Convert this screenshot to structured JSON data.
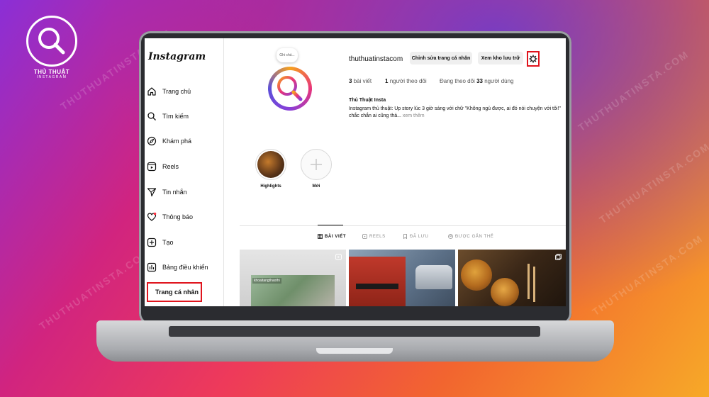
{
  "brand": {
    "line1": "THỦ THUẬT",
    "line2": "INSTAGRAM"
  },
  "watermark": "THUTHUATINSTA.COM",
  "sidebar": {
    "logo": "Instagram",
    "items": [
      {
        "label": "Trang chủ",
        "icon": "home-icon"
      },
      {
        "label": "Tìm kiếm",
        "icon": "search-icon"
      },
      {
        "label": "Khám phá",
        "icon": "compass-icon"
      },
      {
        "label": "Reels",
        "icon": "reels-icon"
      },
      {
        "label": "Tin nhắn",
        "icon": "send-icon"
      },
      {
        "label": "Thông báo",
        "icon": "heart-icon"
      },
      {
        "label": "Tạo",
        "icon": "plus-square-icon"
      },
      {
        "label": "Bảng điều khiển",
        "icon": "dashboard-icon"
      },
      {
        "label": "Trang cá nhân",
        "icon": "profile-avatar-icon"
      }
    ]
  },
  "profile": {
    "note": "Ghi chú...",
    "username": "thuthuatinstacom",
    "edit_button": "Chỉnh sửa trang cá nhân",
    "archive_button": "Xem kho lưu trữ",
    "stats": {
      "posts_count": "3",
      "posts_label": "bài viết",
      "followers_count": "1",
      "followers_label": "người theo dõi",
      "following_prefix": "Đang theo dõi",
      "following_count": "33",
      "following_label": "người dùng"
    },
    "full_name": "Thủ Thuật Insta",
    "bio": "Instagram thủ thuật: Up story lúc 3 giờ sáng với chữ \"Không ngủ được, ai đó nói chuyện với tôi!\" chắc chắn ai cũng thả...",
    "bio_more": "xem thêm"
  },
  "highlights": [
    {
      "label": "Highlights"
    },
    {
      "label": "Mới"
    }
  ],
  "tabs": [
    {
      "label": "BÀI VIẾT",
      "icon": "grid-icon",
      "active": true
    },
    {
      "label": "REELS",
      "icon": "reels-icon",
      "active": false
    },
    {
      "label": "ĐÃ LƯU",
      "icon": "bookmark-icon",
      "active": false
    },
    {
      "label": "ĐƯỢC GẮN THẺ",
      "icon": "tag-icon",
      "active": false
    }
  ],
  "posts": [
    {
      "caption": "khoaitangthaothi"
    }
  ],
  "colors": {
    "highlight_box": "#e0141d",
    "avatar_ring": [
      "#f6a21e",
      "#e8347a",
      "#8a3fd8"
    ]
  }
}
